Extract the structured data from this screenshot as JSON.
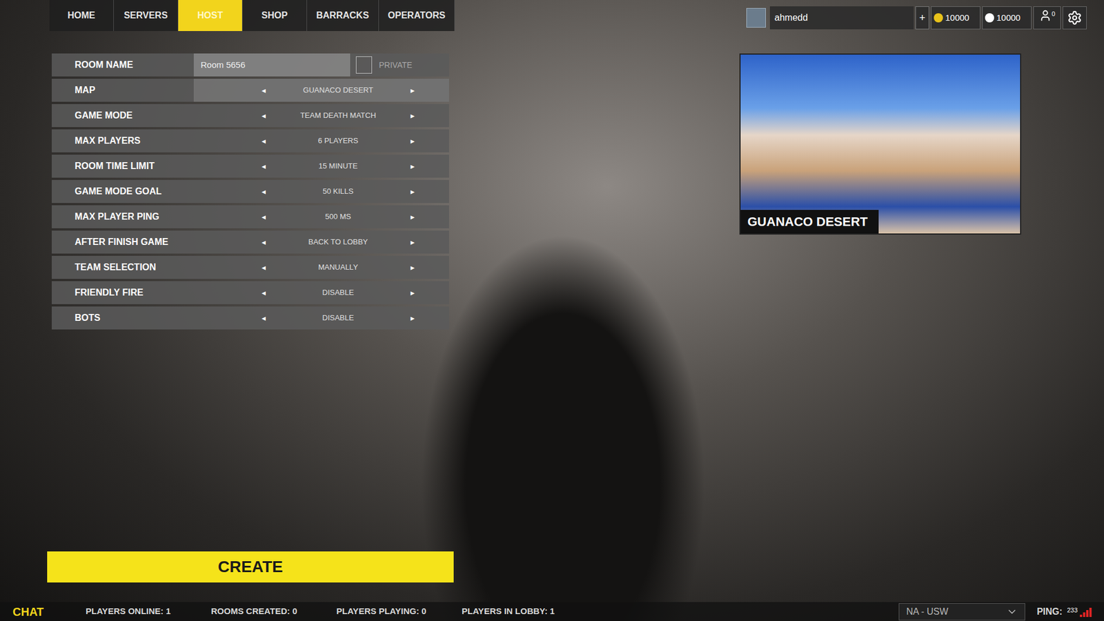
{
  "nav": {
    "tabs": [
      {
        "label": "HOME",
        "selected": false
      },
      {
        "label": "SERVERS",
        "selected": false
      },
      {
        "label": "HOST",
        "selected": true
      },
      {
        "label": "SHOP",
        "selected": false
      },
      {
        "label": "BARRACKS",
        "selected": false
      },
      {
        "label": "OPERATORS",
        "selected": false
      }
    ]
  },
  "account": {
    "username": "ahmedd",
    "add": "+",
    "coins": "10000",
    "credits": "10000",
    "friends": "0"
  },
  "room_name": {
    "label": "ROOM NAME",
    "value": "Room 5656",
    "private_label": "PRIVATE",
    "private": false
  },
  "arrows": {
    "prev": "◂",
    "next": "▸"
  },
  "settings": [
    {
      "label": "MAP",
      "value": "GUANACO DESERT",
      "highlighted": true
    },
    {
      "label": "GAME MODE",
      "value": "TEAM DEATH MATCH",
      "highlighted": false
    },
    {
      "label": "MAX PLAYERS",
      "value": "6 PLAYERS",
      "highlighted": false
    },
    {
      "label": "ROOM TIME LIMIT",
      "value": "15 MINUTE",
      "highlighted": false
    },
    {
      "label": "GAME MODE GOAL",
      "value": "50 KILLS",
      "highlighted": false
    },
    {
      "label": "MAX PLAYER PING",
      "value": "500 MS",
      "highlighted": false
    },
    {
      "label": "AFTER FINISH GAME",
      "value": "BACK TO LOBBY",
      "highlighted": false
    },
    {
      "label": "TEAM SELECTION",
      "value": "MANUALLY",
      "highlighted": false
    },
    {
      "label": "FRIENDLY FIRE",
      "value": "DISABLE",
      "highlighted": false
    },
    {
      "label": "BOTS",
      "value": "DISABLE",
      "highlighted": false
    }
  ],
  "map_preview": {
    "caption": "GUANACO DESERT"
  },
  "create_button": "CREATE",
  "status_bar": {
    "chat": "CHAT",
    "stats": [
      "PLAYERS ONLINE: 1",
      "ROOMS CREATED: 0",
      "PLAYERS PLAYING: 0",
      "PLAYERS IN LOBBY: 1"
    ],
    "region": "NA - USW",
    "ping_label": "PING:",
    "ping": "233",
    "signal_level": 1
  }
}
